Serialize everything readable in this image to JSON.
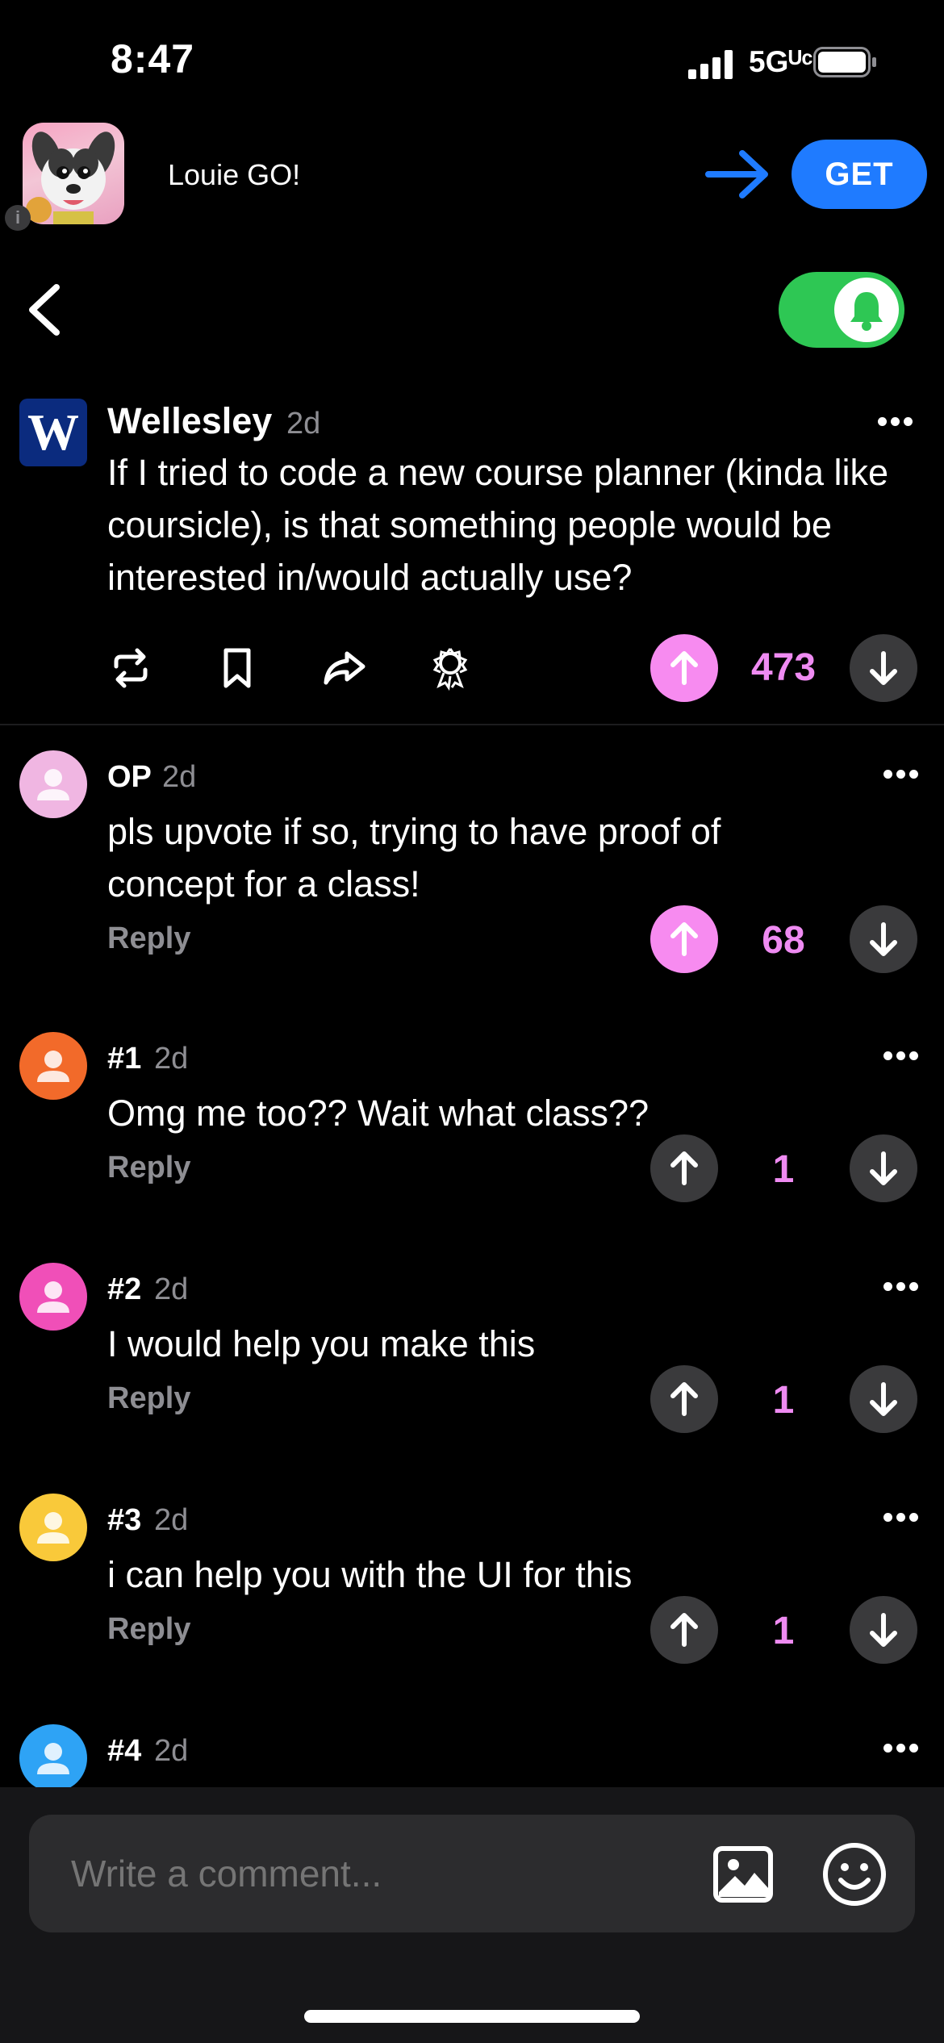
{
  "status_bar": {
    "time": "8:47",
    "network": "5Gᵁᶜ"
  },
  "ad": {
    "title": "Louie GO!",
    "cta": "GET",
    "info_icon": "info-icon"
  },
  "post": {
    "author": "Wellesley",
    "time": "2d",
    "logo_letter": "W",
    "body": "If I tried to code a new course planner (kinda like coursicle), is that something people would be interested in/would actually use?",
    "votes": "473",
    "actions": [
      "repost-icon",
      "bookmark-icon",
      "share-icon",
      "award-icon"
    ]
  },
  "comments": [
    {
      "author": "OP",
      "time": "2d",
      "body": "pls upvote if so, trying to have proof of concept for a class!",
      "reply": "Reply",
      "votes": "68",
      "upvoted": true,
      "avatar_color": "#f0b6e2"
    },
    {
      "author": "#1",
      "time": "2d",
      "body": "Omg me too?? Wait what class??",
      "reply": "Reply",
      "votes": "1",
      "upvoted": false,
      "avatar_color": "#f26a2a"
    },
    {
      "author": "#2",
      "time": "2d",
      "body": "I would help you make this",
      "reply": "Reply",
      "votes": "1",
      "upvoted": false,
      "avatar_color": "#f04fb8"
    },
    {
      "author": "#3",
      "time": "2d",
      "body": "i can help you with the UI for this",
      "reply": "Reply",
      "votes": "1",
      "upvoted": false,
      "avatar_color": "#f9c93a"
    },
    {
      "author": "#4",
      "time": "2d",
      "body": "",
      "reply": "",
      "votes": "",
      "upvoted": false,
      "avatar_color": "#2ea3f5"
    }
  ],
  "composer": {
    "placeholder": "Write a comment..."
  },
  "colors": {
    "accent_pink": "#ef8bf2",
    "get_blue": "#1f7bff",
    "toggle_green": "#2ec754",
    "school_blue": "#0b2b7e"
  }
}
